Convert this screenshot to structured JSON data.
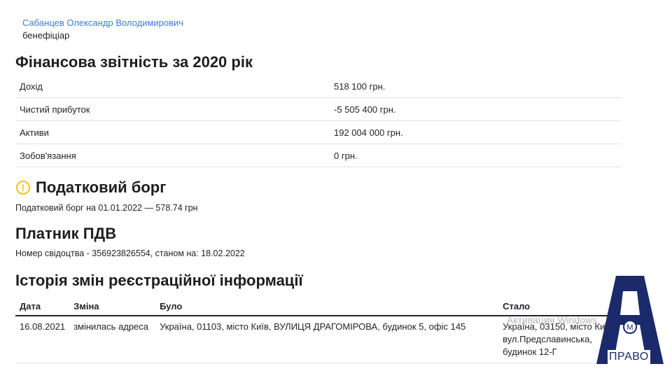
{
  "beneficiary": {
    "name": "Сабанцев Олександр Володимирович",
    "role": "бенефіціар"
  },
  "financial": {
    "title": "Фінансова звітність за 2020 рік",
    "rows": [
      {
        "label": "Дохід",
        "value": "518 100 грн."
      },
      {
        "label": "Чистий прибуток",
        "value": "-5 505 400 грн."
      },
      {
        "label": "Активи",
        "value": "192 004 000 грн."
      },
      {
        "label": "Зобов'язання",
        "value": "0 грн."
      }
    ]
  },
  "tax_debt": {
    "title": "Податковий борг",
    "icon": "warning-icon",
    "text": "Податковий борг на 01.01.2022 — 578.74 грн"
  },
  "vat": {
    "title": "Платник ПДВ",
    "text": "Номер свідоцтва - 356923826554, станом на: 18.02.2022"
  },
  "history": {
    "title": "Історія змін реєстраційної інформації",
    "headers": {
      "date": "Дата",
      "change": "Зміна",
      "before": "Було",
      "after": "Стало"
    },
    "rows": [
      {
        "date": "16.08.2021",
        "change": "змінилась адреса",
        "before": "Україна, 01103, місто Київ, ВУЛИЦЯ ДРАГОМІРОВА, будинок 5, офіс 145",
        "after_lines": [
          "Україна, 03150, місто Київ,",
          "вул.Предславинська,",
          "будинок 12-Г"
        ]
      }
    ]
  },
  "watermark": "Активация Windows",
  "logo": {
    "text": "ПРАВО",
    "color": "#1b2a6b"
  }
}
